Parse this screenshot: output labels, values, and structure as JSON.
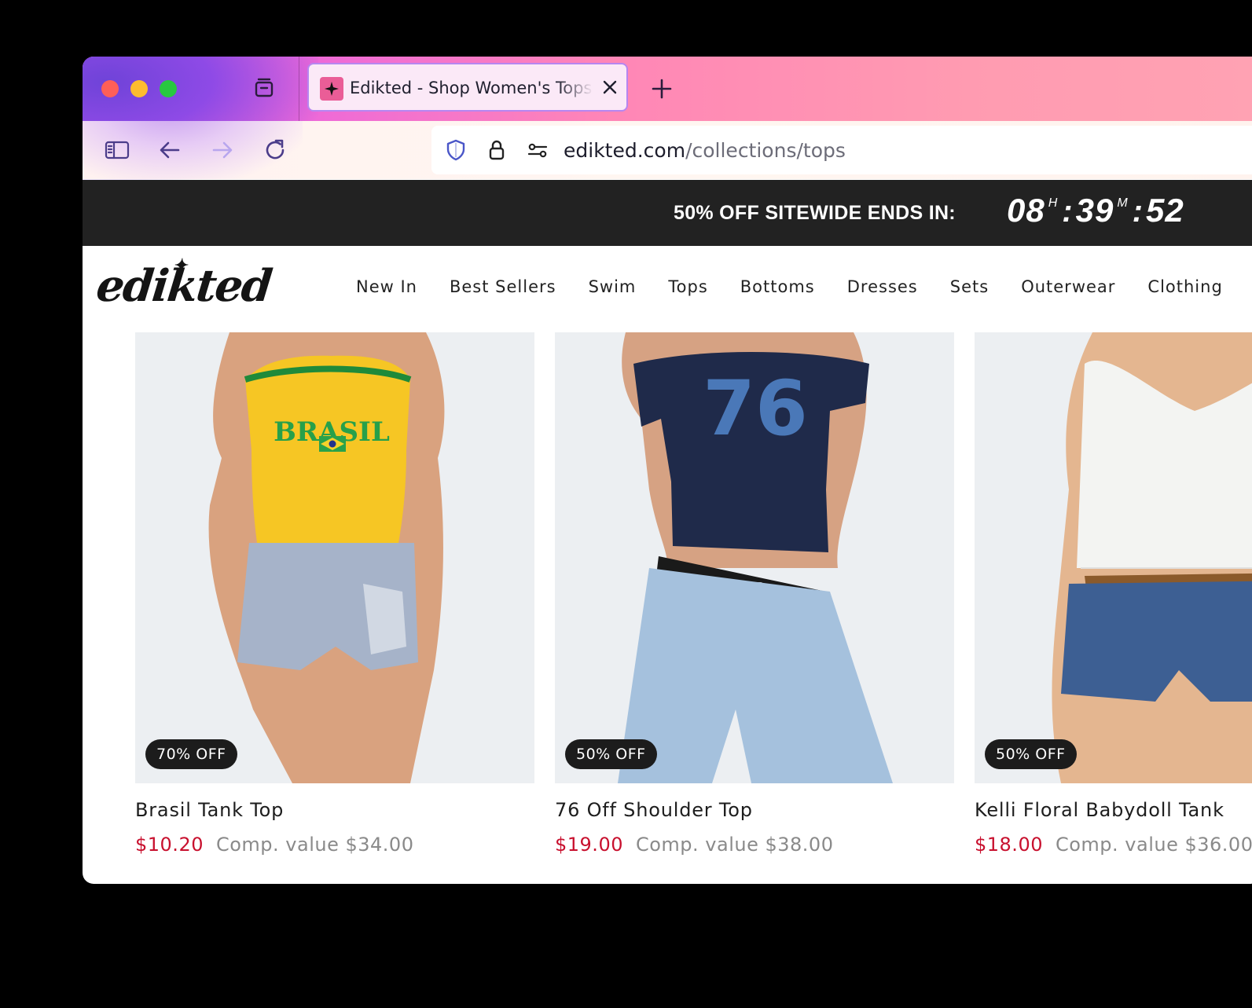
{
  "browser": {
    "tab": {
      "title": "Edikted - Shop Women's Tops – Edikted"
    },
    "url": {
      "host": "edikted.com",
      "path": "/collections/tops"
    }
  },
  "promo": {
    "text": "50% OFF SITEWIDE ENDS IN:",
    "hours": "08",
    "hours_unit": "H",
    "minutes": "39",
    "minutes_unit": "M",
    "seconds": "52"
  },
  "site": {
    "logo": "edikted",
    "nav": [
      "New In",
      "Best Sellers",
      "Swim",
      "Tops",
      "Bottoms",
      "Dresses",
      "Sets",
      "Outerwear",
      "Clothing"
    ]
  },
  "products": [
    {
      "badge": "70% OFF",
      "name": "Brasil Tank Top",
      "price": "$10.20",
      "comp": "Comp. value $34.00",
      "photo_text": "BRASIL",
      "top_color": "#f6c624"
    },
    {
      "badge": "50% OFF",
      "name": "76 Off Shoulder Top",
      "price": "$19.00",
      "comp": "Comp. value $38.00",
      "photo_text": "76",
      "top_color": "#1f2a4a"
    },
    {
      "badge": "50% OFF",
      "name": "Kelli Floral Babydoll Tank",
      "price": "$18.00",
      "comp": "Comp. value $36.00",
      "photo_text": "",
      "top_color": "#f3f4f2"
    }
  ],
  "colors": {
    "accent_price": "#c8102e",
    "promo_bg": "#222222",
    "badge_bg": "#1c1c1c"
  }
}
